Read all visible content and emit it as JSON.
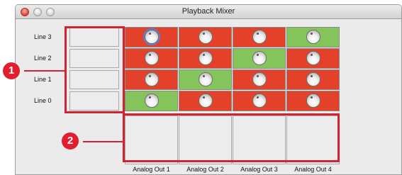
{
  "window": {
    "title": "Playback Mixer"
  },
  "rows": [
    {
      "label": "Line 3",
      "cells": [
        "red",
        "red",
        "red",
        "green"
      ]
    },
    {
      "label": "Line 2",
      "cells": [
        "red",
        "red",
        "green",
        "red"
      ]
    },
    {
      "label": "Line 1",
      "cells": [
        "red",
        "green",
        "red",
        "red"
      ]
    },
    {
      "label": "Line 0",
      "cells": [
        "green",
        "red",
        "red",
        "red"
      ]
    }
  ],
  "outputs": [
    "Analog Out 1",
    "Analog Out 2",
    "Analog Out 3",
    "Analog Out 4"
  ],
  "callouts": [
    "1",
    "2"
  ],
  "colors": {
    "active": "#85c45a",
    "inactive": "#e34129",
    "highlight": "#d42232"
  }
}
